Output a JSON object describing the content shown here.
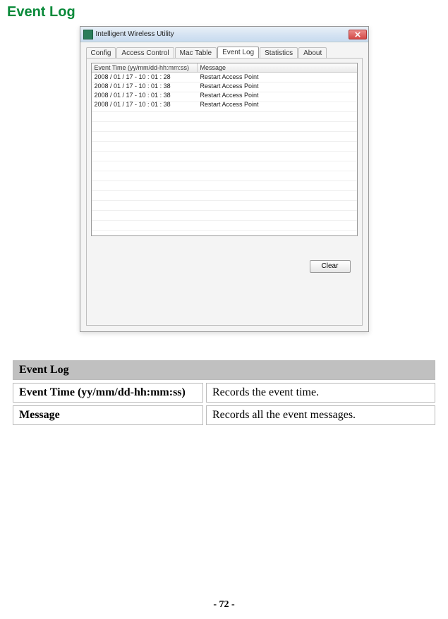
{
  "section_title": "Event Log",
  "dialog": {
    "title": "Intelligent Wireless Utility",
    "tabs": [
      "Config",
      "Access Control",
      "Mac Table",
      "Event Log",
      "Statistics",
      "About"
    ],
    "active_tab_index": 3,
    "listview": {
      "header_time": "Event Time (yy/mm/dd-hh:mm:ss)",
      "header_message": "Message",
      "rows": [
        {
          "time": "2008 / 01 / 17 - 10 : 01 : 28",
          "message": "Restart Access Point"
        },
        {
          "time": "2008 / 01 / 17 - 10 : 01 : 38",
          "message": "Restart Access Point"
        },
        {
          "time": "2008 / 01 / 17 - 10 : 01 : 38",
          "message": "Restart Access Point"
        },
        {
          "time": "2008 / 01 / 17 - 10 : 01 : 38",
          "message": "Restart Access Point"
        }
      ]
    },
    "clear_label": "Clear"
  },
  "description": {
    "header": "Event Log",
    "rows": [
      {
        "key": "Event Time (yy/mm/dd-hh:mm:ss)",
        "val": "Records the event time."
      },
      {
        "key": "Message",
        "val": "Records all the event messages."
      }
    ]
  },
  "page_number": "- 72 -"
}
